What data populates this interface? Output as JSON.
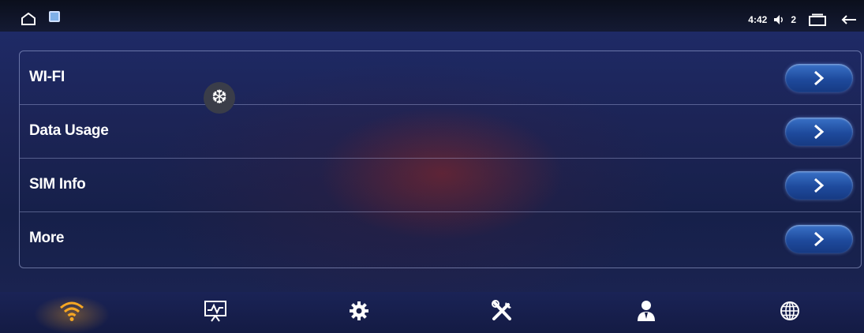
{
  "status_bar": {
    "time": "4:42",
    "volume": "2",
    "icons": [
      "home-outline-icon",
      "screenshot-thumb-icon",
      "volume-icon",
      "recent-apps-icon",
      "back-arrow-icon"
    ]
  },
  "floating_icon": "snowflake-icon",
  "floating_glyph": "❆",
  "settings": {
    "items": [
      {
        "label": "WI-FI",
        "icon": "chevron-right-icon"
      },
      {
        "label": "Data Usage",
        "icon": "chevron-right-icon"
      },
      {
        "label": "SIM Info",
        "icon": "chevron-right-icon"
      },
      {
        "label": "More",
        "icon": "chevron-right-icon"
      }
    ]
  },
  "tabbar": {
    "tabs": [
      {
        "icon": "wifi-icon",
        "active": true
      },
      {
        "icon": "system-monitor-icon",
        "active": false
      },
      {
        "icon": "gear-icon",
        "active": false
      },
      {
        "icon": "tools-icon",
        "active": false
      },
      {
        "icon": "user-account-icon",
        "active": false
      },
      {
        "icon": "globe-icon",
        "active": false
      }
    ]
  },
  "colors": {
    "active_tab": "#f5a623",
    "chevron_button": "#2a5cb4",
    "panel_bg": "#1c2456"
  }
}
